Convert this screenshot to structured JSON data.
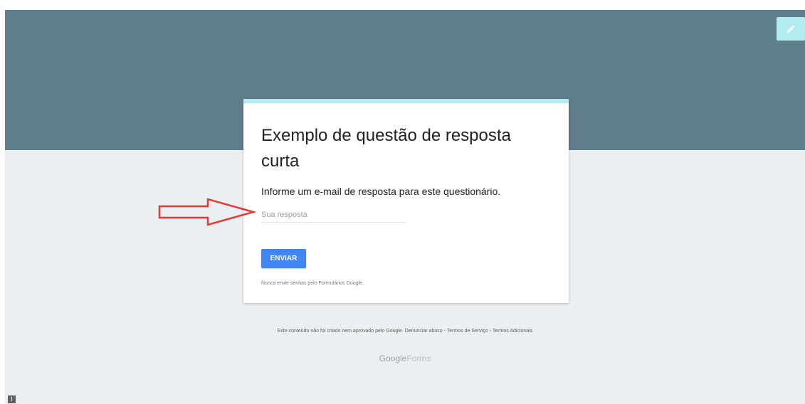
{
  "form": {
    "title": "Exemplo de questão de resposta curta",
    "question": "Informe um e-mail de resposta para este questionário.",
    "answer_placeholder": "Sua resposta",
    "submit_label": "ENVIAR",
    "password_warning": "Nunca envie senhas pelo Formulários Google."
  },
  "footer": {
    "disclaimer": "Este conteúdo não foi criado nem aprovado pelo Google.",
    "report_link": "Denunciar abuso",
    "sep1": " - ",
    "terms_link": "Termos de Serviço",
    "sep2": " - ",
    "additional_link": "Termos Adicionais",
    "brand_google": "Google",
    "brand_forms": "Forms"
  },
  "icons": {
    "edit": "edit-icon",
    "report": "report-icon"
  },
  "colors": {
    "header": "#607d8b",
    "background": "#eceff1",
    "accent": "#b2ebf2",
    "button": "#4285f4",
    "annotation_arrow": "#e53935"
  },
  "annotation": {
    "type": "red-arrow",
    "points_to": "answer-input"
  }
}
